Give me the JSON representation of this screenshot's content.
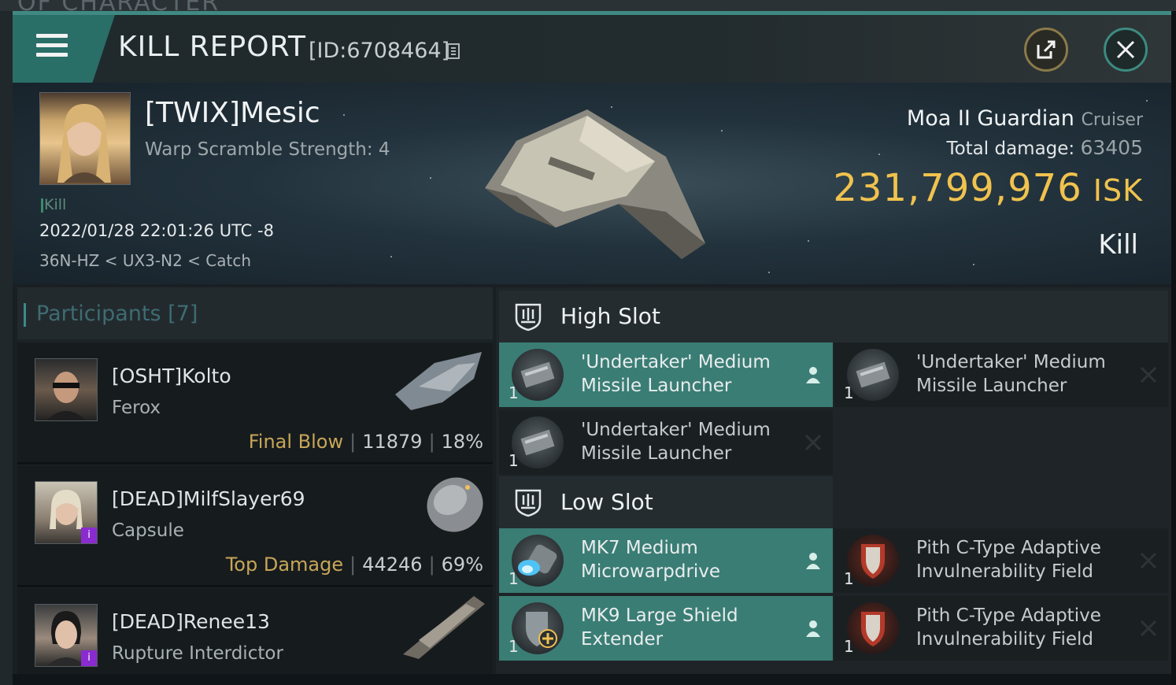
{
  "background": {
    "partial_title": "OF CHARACTER"
  },
  "header": {
    "title": "KILL REPORT",
    "report_id": "[ID:6708464]",
    "menu_icon": "hamburger-icon",
    "share_icon": "share-icon",
    "close_icon": "close-icon"
  },
  "victim": {
    "name": "[TWIX]Mesic",
    "detail": "Warp Scramble Strength: 4",
    "tag": "Kill",
    "datetime": "2022/01/28 22:01:26 UTC -8",
    "location": "36N-HZ < UX3-N2 < Catch",
    "ship": "Moa II Guardian",
    "ship_class": "Cruiser",
    "total_damage_label": "Total damage:",
    "total_damage": "63405",
    "isk_value": "231,799,976",
    "isk_unit": "ISK",
    "outcome": "Kill"
  },
  "participants": {
    "title": "Participants [7]",
    "rows": [
      {
        "name": "[OSHT]Kolto",
        "ship": "Ferox",
        "label": "Final Blow",
        "damage": "11879",
        "percent": "18%"
      },
      {
        "name": "[DEAD]MilfSlayer69",
        "ship": "Capsule",
        "label": "Top Damage",
        "damage": "44246",
        "percent": "69%"
      },
      {
        "name": "[DEAD]Renee13",
        "ship": "Rupture Interdictor"
      }
    ]
  },
  "fitting": {
    "high_slot_title": "High Slot",
    "low_slot_title": "Low Slot",
    "high": [
      {
        "name_line1": "'Undertaker' Medium",
        "name_line2": "Missile Launcher",
        "qty": "1",
        "state": "dropped"
      },
      {
        "name_line1": "'Undertaker' Medium",
        "name_line2": "Missile Launcher",
        "qty": "1",
        "state": "destroyed"
      },
      {
        "name_line1": "'Undertaker' Medium",
        "name_line2": "Missile Launcher",
        "qty": "1",
        "state": "destroyed"
      }
    ],
    "low": [
      {
        "name_line1": "MK7 Medium",
        "name_line2": "Microwarpdrive",
        "qty": "1",
        "state": "dropped"
      },
      {
        "name_line1": "Pith C-Type Adaptive",
        "name_line2": "Invulnerability Field",
        "qty": "1",
        "state": "destroyed"
      },
      {
        "name_line1": "MK9 Large Shield",
        "name_line2": "Extender",
        "qty": "1",
        "state": "dropped"
      },
      {
        "name_line1": "Pith C-Type Adaptive",
        "name_line2": "Invulnerability Field",
        "qty": "1",
        "state": "destroyed"
      }
    ]
  },
  "colors": {
    "accent": "#3a7d74",
    "isk": "#f0c24e",
    "label_gold": "#c7a657"
  }
}
